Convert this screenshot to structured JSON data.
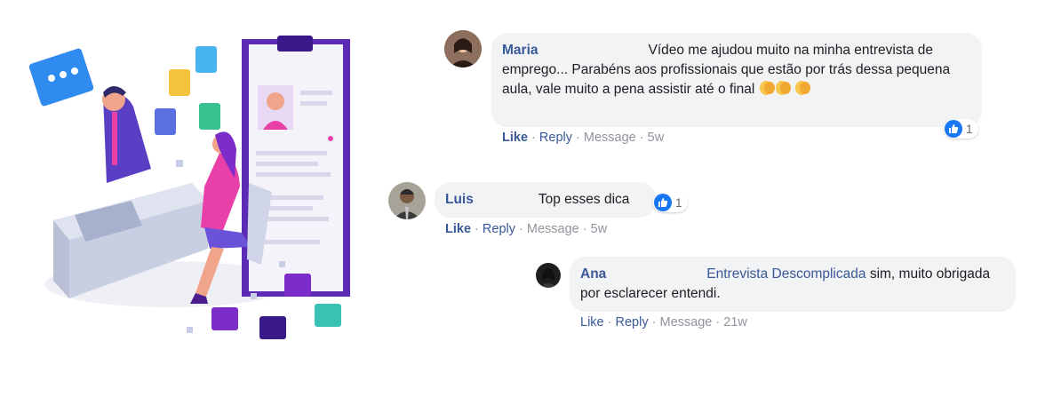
{
  "comments": [
    {
      "author": "Maria",
      "text": "Vídeo me ajudou muito na minha entrevista de emprego... Parabéns aos profissionais que estão por trás dessa pequena aula, vale muito a pena assistir até o final",
      "reaction_icon": "like-icon",
      "reaction_count": "1",
      "actions": {
        "like": "Like",
        "reply": "Reply",
        "message": "Message",
        "time": "5w"
      }
    },
    {
      "author": "Luis",
      "text": "Top esses dica",
      "reaction_icon": "like-icon",
      "reaction_count": "1",
      "actions": {
        "like": "Like",
        "reply": "Reply",
        "message": "Message",
        "time": "5w"
      }
    },
    {
      "author": "Ana",
      "mention": "Entrevista Descomplicada",
      "text": "sim, muito obrigada por esclarecer entendi.",
      "actions": {
        "like": "Like",
        "reply": "Reply",
        "message": "Message",
        "time": "21w"
      }
    }
  ],
  "separator": "·",
  "colors": {
    "link": "#385898",
    "meta": "#90949c",
    "bubble": "#f2f3f5",
    "like": "#1877f2",
    "illustration_purple": "#5b2bb5",
    "illustration_pink": "#e93fa8"
  }
}
